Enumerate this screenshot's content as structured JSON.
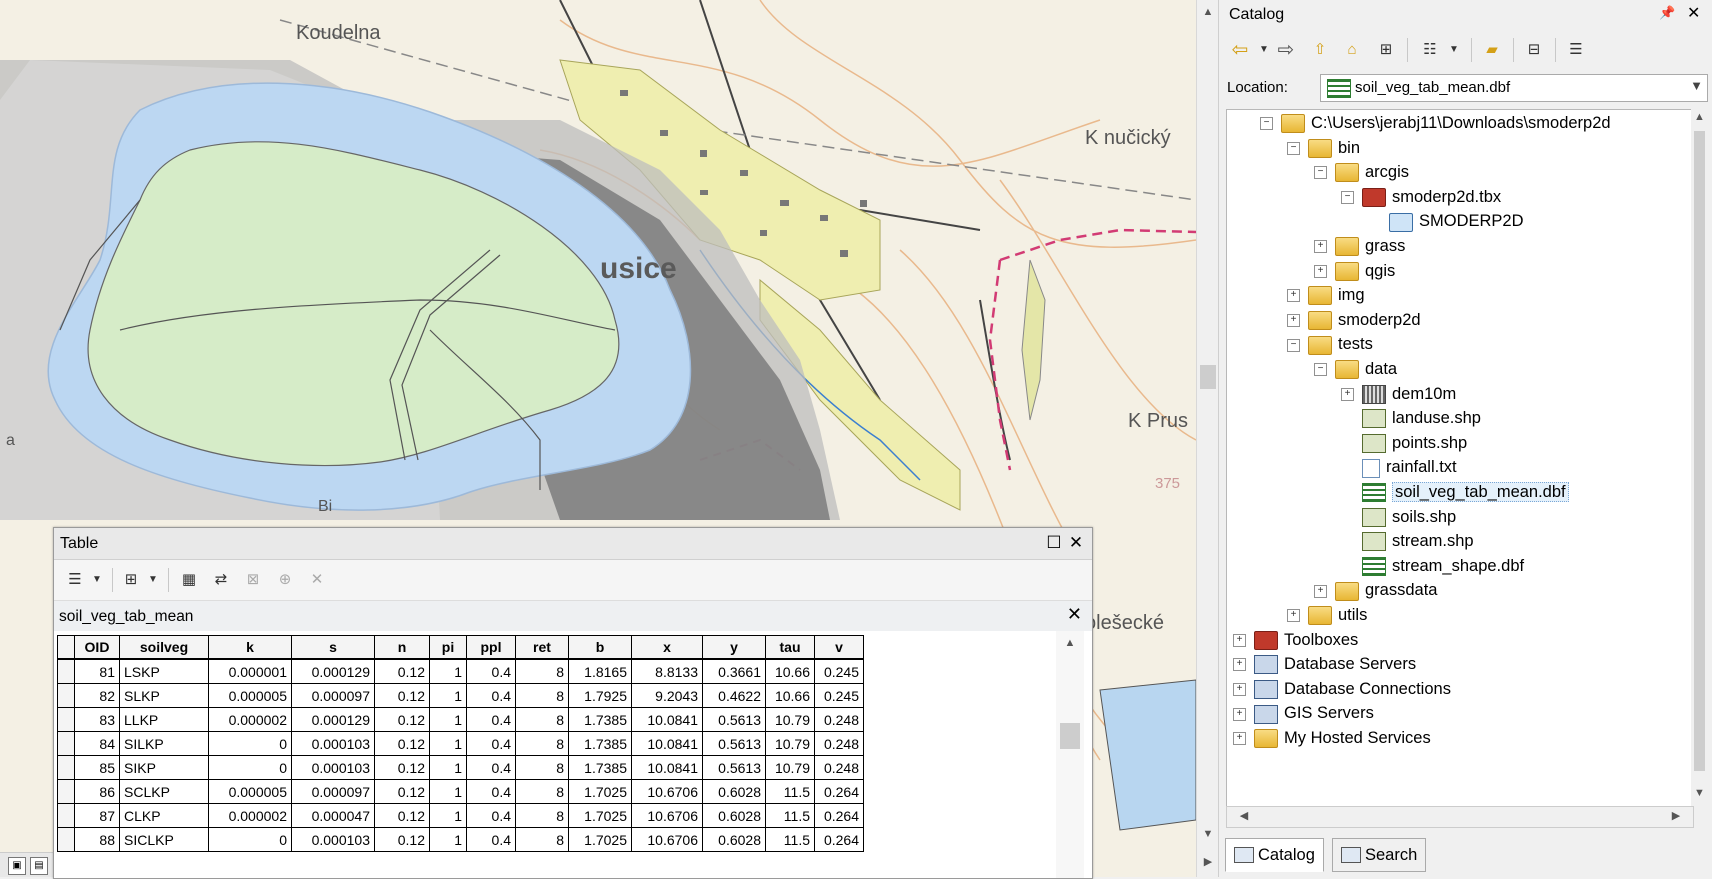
{
  "map": {
    "labels": [
      "Koudelna",
      "K nučický",
      "K Prus",
      "olešecké",
      "usice",
      "375",
      "Bi",
      "a"
    ]
  },
  "table_window": {
    "title": "Table",
    "tab_name": "soil_veg_tab_mean",
    "columns": [
      "OID",
      "soilveg",
      "k",
      "s",
      "n",
      "pi",
      "ppl",
      "ret",
      "b",
      "x",
      "y",
      "tau",
      "v"
    ],
    "rows": [
      [
        "81",
        "LSKP",
        "0.000001",
        "0.000129",
        "0.12",
        "1",
        "0.4",
        "8",
        "1.8165",
        "8.8133",
        "0.3661",
        "10.66",
        "0.245"
      ],
      [
        "82",
        "SLKP",
        "0.000005",
        "0.000097",
        "0.12",
        "1",
        "0.4",
        "8",
        "1.7925",
        "9.2043",
        "0.4622",
        "10.66",
        "0.245"
      ],
      [
        "83",
        "LLKP",
        "0.000002",
        "0.000129",
        "0.12",
        "1",
        "0.4",
        "8",
        "1.7385",
        "10.0841",
        "0.5613",
        "10.79",
        "0.248"
      ],
      [
        "84",
        "SILKP",
        "0",
        "0.000103",
        "0.12",
        "1",
        "0.4",
        "8",
        "1.7385",
        "10.0841",
        "0.5613",
        "10.79",
        "0.248"
      ],
      [
        "85",
        "SIKP",
        "0",
        "0.000103",
        "0.12",
        "1",
        "0.4",
        "8",
        "1.7385",
        "10.0841",
        "0.5613",
        "10.79",
        "0.248"
      ],
      [
        "86",
        "SCLKP",
        "0.000005",
        "0.000097",
        "0.12",
        "1",
        "0.4",
        "8",
        "1.7025",
        "10.6706",
        "0.6028",
        "11.5",
        "0.264"
      ],
      [
        "87",
        "CLKP",
        "0.000002",
        "0.000047",
        "0.12",
        "1",
        "0.4",
        "8",
        "1.7025",
        "10.6706",
        "0.6028",
        "11.5",
        "0.264"
      ],
      [
        "88",
        "SICLKP",
        "0",
        "0.000103",
        "0.12",
        "1",
        "0.4",
        "8",
        "1.7025",
        "10.6706",
        "0.6028",
        "11.5",
        "0.264"
      ]
    ]
  },
  "catalog": {
    "title": "Catalog",
    "location_label": "Location:",
    "location_value": "soil_veg_tab_mean.dbf",
    "tree": [
      {
        "label": "C:\\Users\\jerabj11\\Downloads\\smoderp2d",
        "level": 1,
        "exp": "−",
        "icon": "folder-icon"
      },
      {
        "label": "bin",
        "level": 2,
        "exp": "−",
        "icon": "folder-icon"
      },
      {
        "label": "arcgis",
        "level": 3,
        "exp": "−",
        "icon": "folder-icon"
      },
      {
        "label": "smoderp2d.tbx",
        "level": 4,
        "exp": "−",
        "icon": "toolbox-icon"
      },
      {
        "label": "SMODERP2D",
        "level": 5,
        "exp": "",
        "icon": "script-icon"
      },
      {
        "label": "grass",
        "level": 3,
        "exp": "+",
        "icon": "folder-icon"
      },
      {
        "label": "qgis",
        "level": 3,
        "exp": "+",
        "icon": "folder-icon"
      },
      {
        "label": "img",
        "level": 2,
        "exp": "+",
        "icon": "folder-icon"
      },
      {
        "label": "smoderp2d",
        "level": 2,
        "exp": "+",
        "icon": "folder-icon"
      },
      {
        "label": "tests",
        "level": 2,
        "exp": "−",
        "icon": "folder-icon"
      },
      {
        "label": "data",
        "level": 3,
        "exp": "−",
        "icon": "folder-icon"
      },
      {
        "label": "dem10m",
        "level": 4,
        "exp": "+",
        "icon": "raster-icon"
      },
      {
        "label": "landuse.shp",
        "level": 4,
        "exp": "",
        "icon": "polygon-shapefile-icon"
      },
      {
        "label": "points.shp",
        "level": 4,
        "exp": "",
        "icon": "point-shapefile-icon"
      },
      {
        "label": "rainfall.txt",
        "level": 4,
        "exp": "",
        "icon": "text-file-icon"
      },
      {
        "label": "soil_veg_tab_mean.dbf",
        "level": 4,
        "exp": "",
        "icon": "table-icon",
        "selected": true
      },
      {
        "label": "soils.shp",
        "level": 4,
        "exp": "",
        "icon": "polygon-shapefile-icon"
      },
      {
        "label": "stream.shp",
        "level": 4,
        "exp": "",
        "icon": "line-shapefile-icon"
      },
      {
        "label": "stream_shape.dbf",
        "level": 4,
        "exp": "",
        "icon": "table-icon"
      },
      {
        "label": "grassdata",
        "level": 3,
        "exp": "+",
        "icon": "folder-icon"
      },
      {
        "label": "utils",
        "level": 2,
        "exp": "+",
        "icon": "folder-icon"
      },
      {
        "label": "Toolboxes",
        "level": 0,
        "exp": "+",
        "icon": "toolboxes-icon"
      },
      {
        "label": "Database Servers",
        "level": 0,
        "exp": "+",
        "icon": "database-servers-icon"
      },
      {
        "label": "Database Connections",
        "level": 0,
        "exp": "+",
        "icon": "database-connections-icon"
      },
      {
        "label": "GIS Servers",
        "level": 0,
        "exp": "+",
        "icon": "gis-servers-icon"
      },
      {
        "label": "My Hosted Services",
        "level": 0,
        "exp": "+",
        "icon": "hosted-services-icon"
      }
    ],
    "tabs": [
      {
        "label": "Catalog",
        "icon": "catalog-icon",
        "active": true
      },
      {
        "label": "Search",
        "icon": "search-icon",
        "active": false
      }
    ]
  }
}
